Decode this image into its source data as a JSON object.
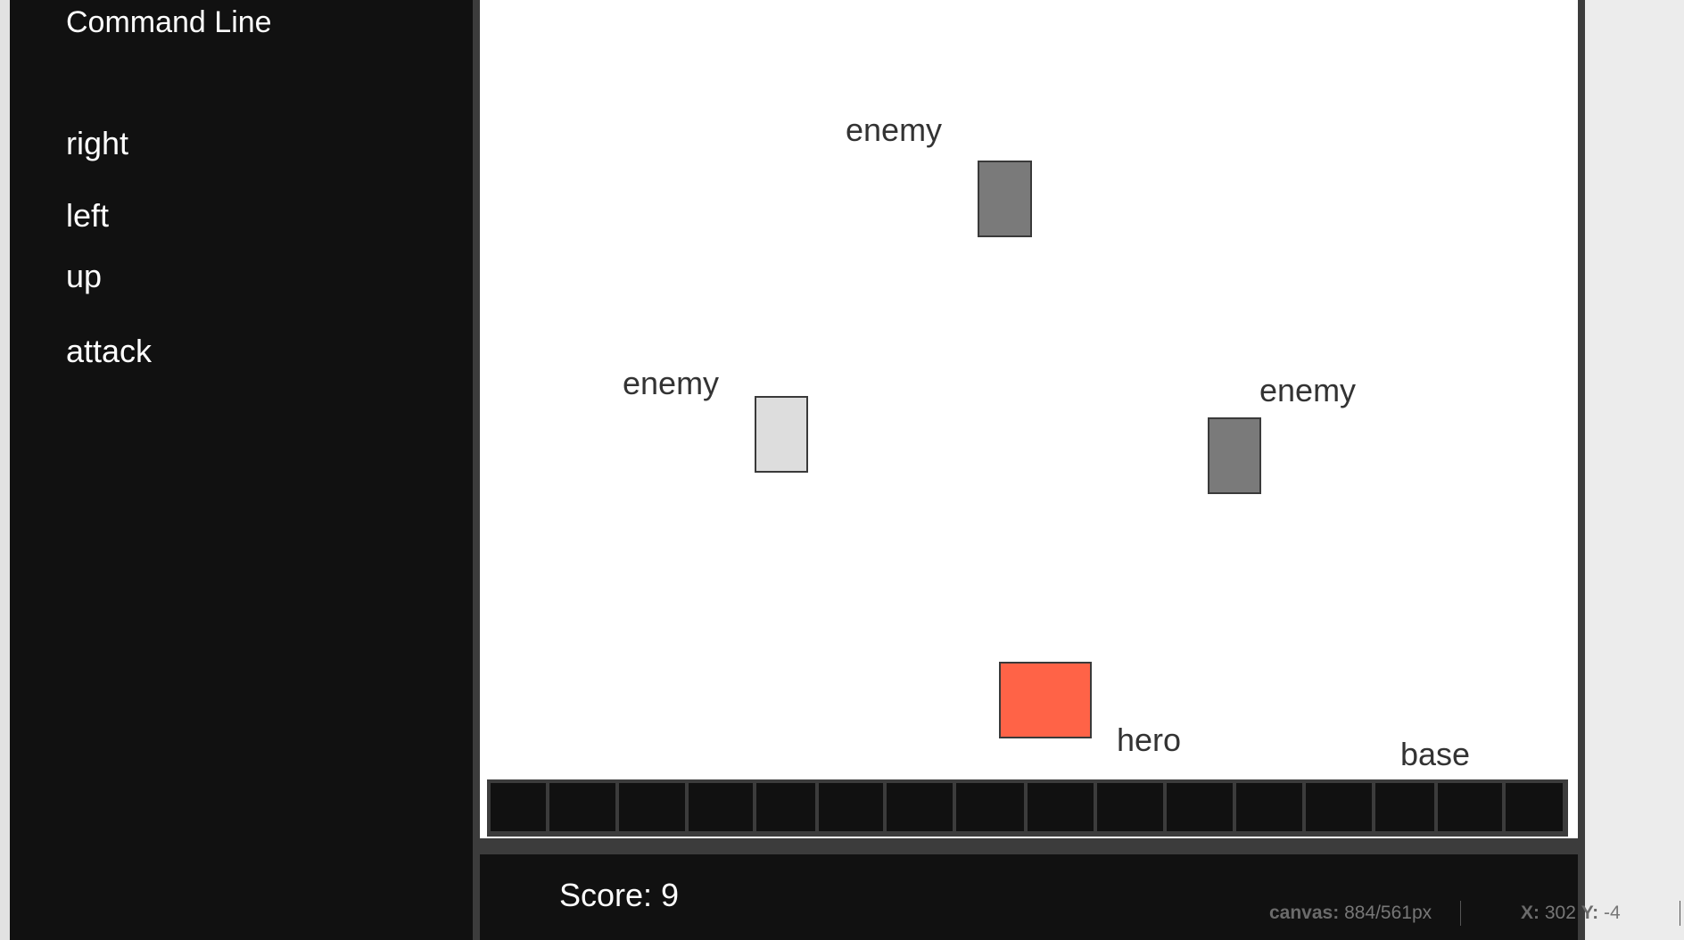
{
  "sidebar": {
    "title": "Command Line",
    "commands": [
      "right",
      "left",
      "up",
      "attack"
    ]
  },
  "canvas": {
    "entities": [
      {
        "label": "enemy",
        "color": "#7a7a7a"
      },
      {
        "label": "enemy",
        "color": "#dddddd"
      },
      {
        "label": "enemy",
        "color": "#7a7a7a"
      },
      {
        "label": "hero",
        "color": "#ff6347"
      },
      {
        "label": "base"
      }
    ]
  },
  "score": {
    "text": "Score: 9"
  },
  "status": {
    "canvas_label": "canvas:",
    "canvas_value": "884/561px",
    "x_label": "X:",
    "x_value": "302",
    "y_label": "Y:",
    "y_value": "-4"
  }
}
